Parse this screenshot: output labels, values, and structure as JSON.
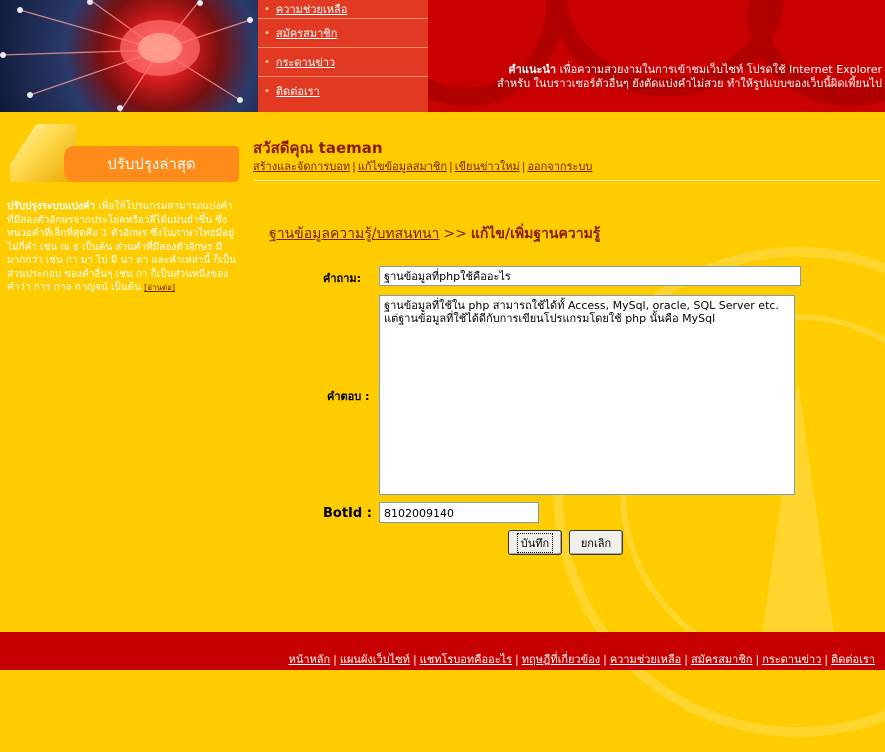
{
  "menu": {
    "items": [
      {
        "label": "ความช่วยเหลือ"
      },
      {
        "label": "สมัครสมาชิก"
      },
      {
        "label": "กระดานข่าว"
      },
      {
        "label": "ติดต่อเรา"
      }
    ]
  },
  "notice": {
    "title": "คำแนะนำ",
    "line1": "เพื่อความสวยงามในการเข้าชมเว็บไซท์ โปรดใช้ Internet Explorer",
    "line2": "สำหรับ ในบราวเซอร์ตัวอื่นๆ ยังตัดแบ่งคำไม่สวย ทำให้รูปแบบของเว็บนี้ผิดเพี้ยนไป"
  },
  "sidebar": {
    "tab_label": "ปรับปรุงล่าสุด",
    "heading": "ปรับปรุงระบบแบ่งคำ",
    "body": "เพื่อให้โปรแกรมสามารถแบ่งคำ ที่มีสองตัวอักษรจากประโยคหรือวลีได้แม่นยำขึ้น ซึ่งหน่วยคำที่เล็กที่สุดคือ 1 ตัวอักษร ซึ่งในภาษาไทยมีอยู่ไม่กี่คำ เช่น ณ ธ เป็นต้น ส่วนคำที่มีสองตัวอักษร มีมากกว่า เช่น กา มา ไป มี นา ตา และคำเหล่านี้ ก็เป็นส่วนประกอบ ของคำอื่นๆ เช่น กา ก็เป็นส่วนหนึ่งของคำว่า การ กาล กาญจน์ เป็นต้น",
    "more": "[อ่านต่อ]"
  },
  "greeting": {
    "text": "สวัสดีคุณ taeman",
    "links": [
      "สร้างและจัดการบอท",
      "แก้ไขข้อมูลสมาชิก",
      "เขียนข่าวใหม่",
      "ออกจากระบบ"
    ]
  },
  "breadcrumb": {
    "parent": "ฐานข้อมูลความรู้/บทสนทนา",
    "arrow": ">>",
    "current": "แก้ไข/เพิ่มฐานความรู้"
  },
  "form": {
    "question_label": "คำถาม:",
    "question_value": "ฐานข้อมูลที่phpใช้คืออะไร",
    "answer_label": "คำตอบ :",
    "answer_line1": "ฐานข้อมูลที่ใช้ใน php สามารถใช้ได้ทั้ Access, MySql, oracle, SQL Server etc.",
    "answer_line2": "แต่ฐานข้อมูลที่ใช้ได้ดีกับการเขียนโปรแกรมโดยใช้ php นั้นคือ MySql",
    "botid_label": "BotId :",
    "botid_value": "8102009140",
    "save_label": "บันทึก",
    "cancel_label": "ยกเลิก"
  },
  "footer": {
    "links": [
      "หน้าหลัก",
      "แผนผังเว็บไซท์",
      "แชทโรบอทคืออะไร",
      "ทฤษฎีที่เกี่ยวข้อง",
      "ความช่วยเหลือ",
      "สมัครสมาชิก",
      "กระดานข่าว",
      "ติดต่อเรา"
    ]
  },
  "colors": {
    "header_red": "#c60000",
    "page_yellow": "#ffcc00",
    "menu_orange": "#e23a22",
    "tab_orange": "#ff8c1a",
    "link_brown": "#7a2200"
  }
}
